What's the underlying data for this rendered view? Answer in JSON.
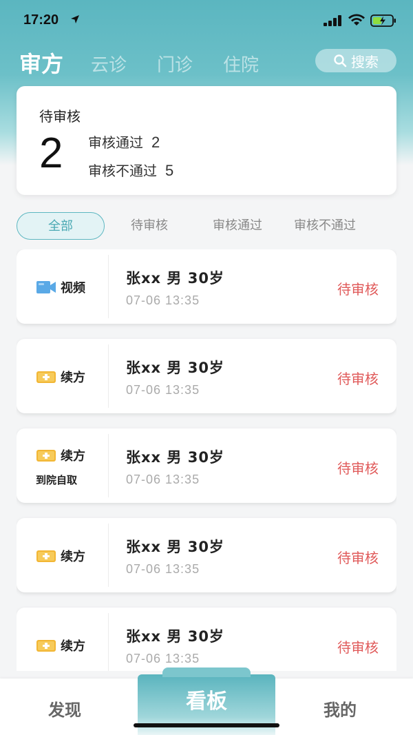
{
  "status_bar": {
    "time": "17:20"
  },
  "top_nav": {
    "tabs": [
      {
        "label": "审方",
        "active": true
      },
      {
        "label": "云诊",
        "active": false
      },
      {
        "label": "门诊",
        "active": false
      },
      {
        "label": "住院",
        "active": false
      }
    ],
    "search_label": "搜索"
  },
  "summary": {
    "title": "待审核",
    "pending_count": "2",
    "approved_label": "审核通过",
    "approved_count": "2",
    "rejected_label": "审核不通过",
    "rejected_count": "5"
  },
  "filters": [
    {
      "label": "全部",
      "active": true
    },
    {
      "label": "待审核",
      "active": false
    },
    {
      "label": "审核通过",
      "active": false
    },
    {
      "label": "审核不通过",
      "active": false
    }
  ],
  "records": [
    {
      "type": "视频",
      "icon": "video-icon",
      "sub": "",
      "patient": "张xx  男  30岁",
      "time": "07-06 13:35",
      "status": "待审核"
    },
    {
      "type": "续方",
      "icon": "renewal-icon",
      "sub": "",
      "patient": "张xx  男  30岁",
      "time": "07-06 13:35",
      "status": "待审核"
    },
    {
      "type": "续方",
      "icon": "renewal-icon",
      "sub": "到院自取",
      "patient": "张xx  男  30岁",
      "time": "07-06 13:35",
      "status": "待审核"
    },
    {
      "type": "续方",
      "icon": "renewal-icon",
      "sub": "",
      "patient": "张xx  男  30岁",
      "time": "07-06 13:35",
      "status": "待审核"
    },
    {
      "type": "续方",
      "icon": "renewal-icon",
      "sub": "",
      "patient": "张xx  男  30岁",
      "time": "07-06 13:35",
      "status": "待审核"
    }
  ],
  "bottom_nav": {
    "left": "发现",
    "center": "看板",
    "right": "我的"
  },
  "colors": {
    "accent": "#5bb6c0",
    "status_pending": "#e05a5a",
    "video_icon": "#5aa9e6",
    "renewal_icon": "#f2b634"
  }
}
